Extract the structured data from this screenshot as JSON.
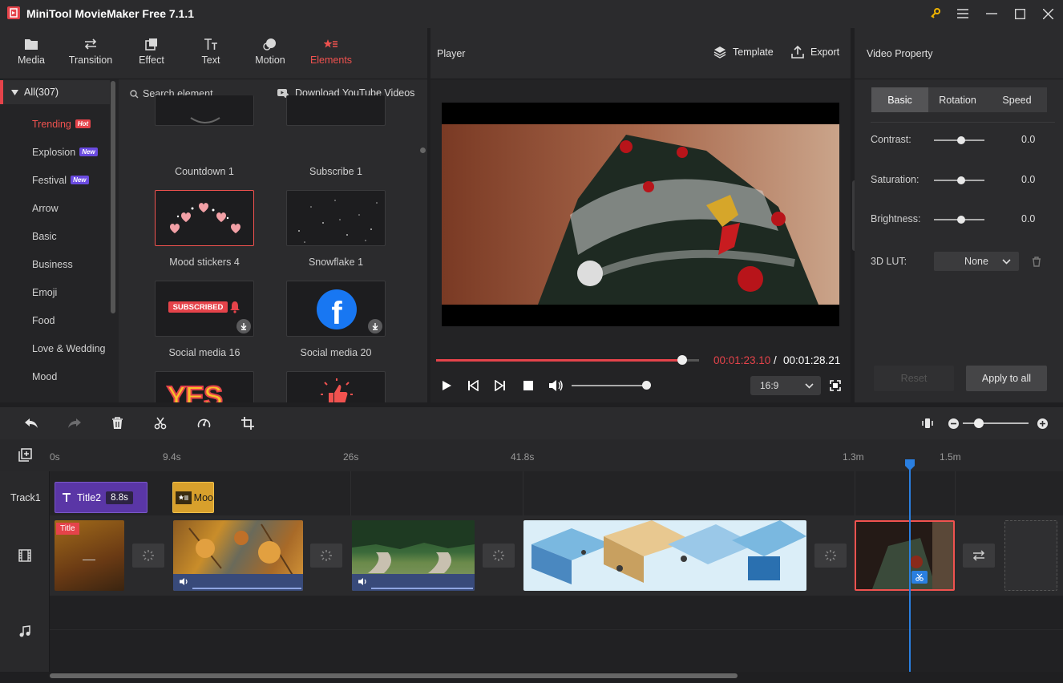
{
  "app": {
    "title": "MiniTool MovieMaker Free 7.1.1"
  },
  "colors": {
    "accent": "#e5434a",
    "playhead": "#2a7fe0",
    "selected_clip_border": "#f0524f"
  },
  "tool_tabs": [
    {
      "label": "Media",
      "icon": "folder-icon"
    },
    {
      "label": "Transition",
      "icon": "transition-arrows-icon"
    },
    {
      "label": "Effect",
      "icon": "effect-icon"
    },
    {
      "label": "Text",
      "icon": "text-icon"
    },
    {
      "label": "Motion",
      "icon": "motion-icon"
    },
    {
      "label": "Elements",
      "icon": "elements-icon",
      "active": true
    }
  ],
  "categories": {
    "all_label": "All(307)",
    "items": [
      {
        "label": "Trending",
        "badge": "Hot",
        "active": true
      },
      {
        "label": "Explosion",
        "badge": "New"
      },
      {
        "label": "Festival",
        "badge": "New"
      },
      {
        "label": "Arrow"
      },
      {
        "label": "Basic"
      },
      {
        "label": "Business"
      },
      {
        "label": "Emoji"
      },
      {
        "label": "Food"
      },
      {
        "label": "Love & Wedding"
      },
      {
        "label": "Mood"
      }
    ]
  },
  "elements": {
    "search_placeholder": "Search element",
    "download_youtube": "Download YouTube Videos",
    "items": [
      {
        "label": "Countdown 1"
      },
      {
        "label": "Subscribe 1"
      },
      {
        "label": "Mood stickers 4",
        "selected": true
      },
      {
        "label": "Snowflake 1"
      },
      {
        "label": "Social media 16",
        "thumb_text": "SUBSCRIBED"
      },
      {
        "label": "Social media 20",
        "thumb_text": "f"
      },
      {
        "label": "",
        "thumb_text": "YES"
      },
      {
        "label": ""
      }
    ]
  },
  "player": {
    "title": "Player",
    "template_label": "Template",
    "export_label": "Export",
    "time_current": "00:01:23.10",
    "time_separator": "/",
    "time_total": "00:01:28.21",
    "progress": 0.94,
    "volume": 0.9,
    "aspect": "16:9"
  },
  "property": {
    "title": "Video Property",
    "tabs": [
      "Basic",
      "Rotation",
      "Speed"
    ],
    "active_tab": "Basic",
    "rows": [
      {
        "label": "Contrast:",
        "value": "0.0"
      },
      {
        "label": "Saturation:",
        "value": "0.0"
      },
      {
        "label": "Brightness:",
        "value": "0.0"
      }
    ],
    "lut_label": "3D LUT:",
    "lut_value": "None",
    "reset_label": "Reset",
    "apply_all_label": "Apply to all"
  },
  "timeline": {
    "ruler": [
      "0s",
      "9.4s",
      "26s",
      "41.8s",
      "1.3m",
      "1.5m"
    ],
    "track1_label": "Track1",
    "title_clip": {
      "label": "Title2",
      "duration": "8.8s"
    },
    "element_clip": {
      "label": "Moo"
    },
    "first_clip_badge": "Title",
    "zoom": 0.25
  }
}
